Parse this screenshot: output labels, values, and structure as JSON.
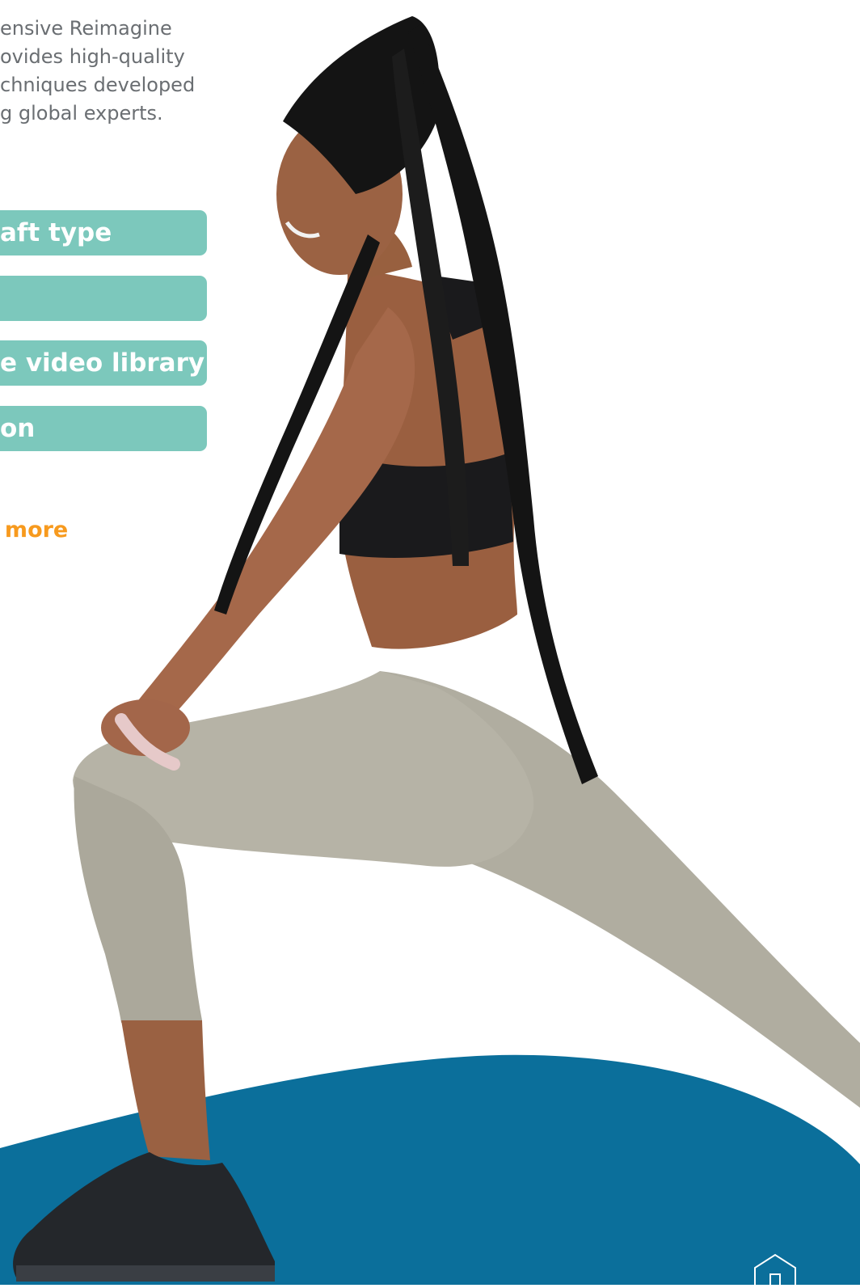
{
  "intro": {
    "lines": [
      "ensive Reimagine",
      "ovides high-quality",
      "chniques developed",
      "g global experts."
    ]
  },
  "menu": {
    "items": [
      {
        "label": "aft type"
      },
      {
        "label": ""
      },
      {
        "label": "e video library"
      },
      {
        "label": "on"
      }
    ]
  },
  "cta": {
    "learn_more": "rn more"
  },
  "icons": {
    "home": "home-icon"
  },
  "colors": {
    "pill_bg": "#7cc8bc",
    "pill_text": "#ffffff",
    "cta": "#f79a1e",
    "wave": "#0b6f9b",
    "intro_text": "#6a6e72"
  }
}
